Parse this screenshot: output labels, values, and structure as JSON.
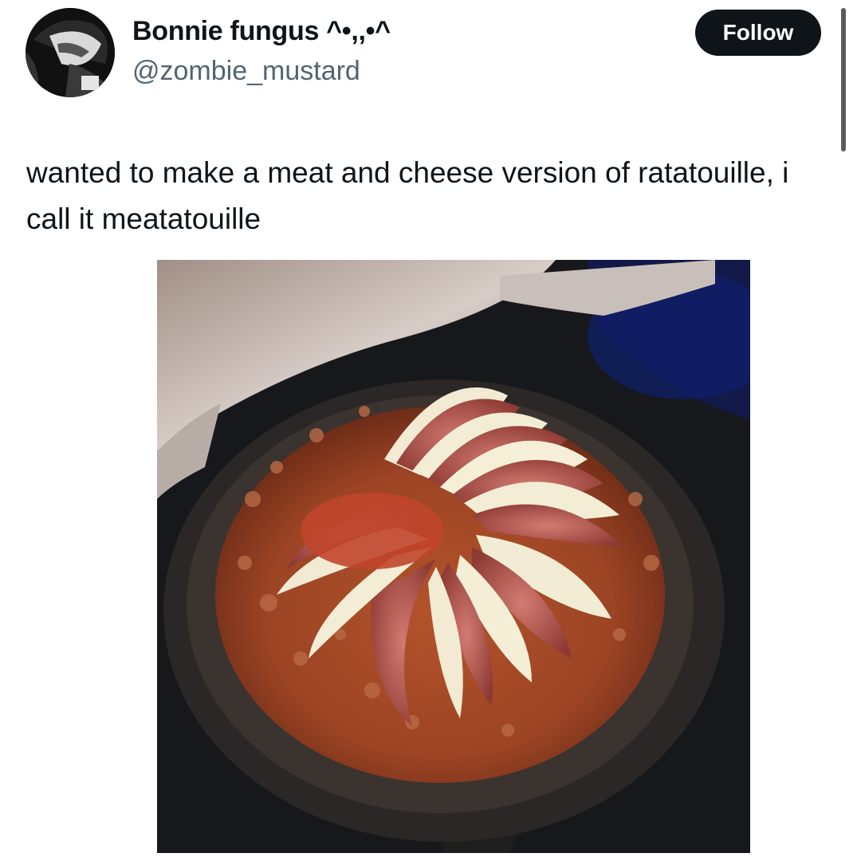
{
  "author": {
    "display_name": "Bonnie fungus ^•,,•^",
    "handle": "@zombie_mustard",
    "avatar_icon": "profile-avatar"
  },
  "actions": {
    "follow_label": "Follow"
  },
  "tweet": {
    "text": "wanted to make a meat and cheese version of ratatouille, i call it meatatouille"
  },
  "media": {
    "icon": "photo-skillet-meatatouille"
  },
  "colors": {
    "button_bg": "#0f1419",
    "handle": "#536471",
    "text": "#0f1419"
  }
}
